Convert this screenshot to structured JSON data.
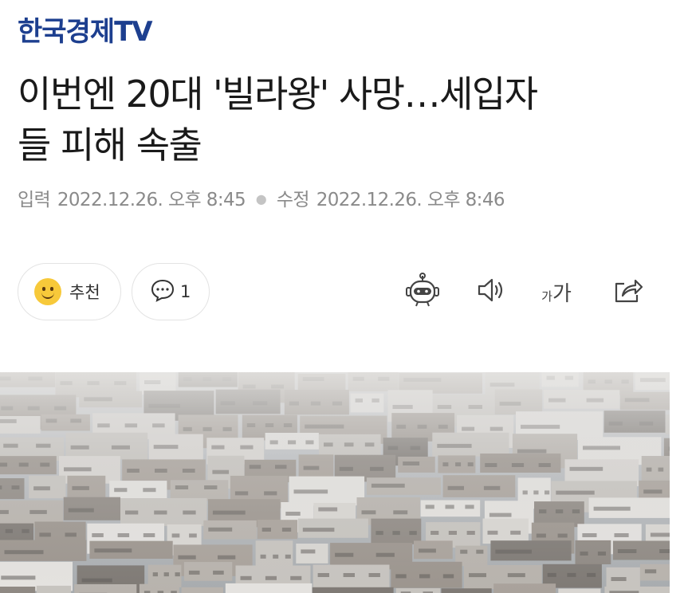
{
  "brand": {
    "name": "한국경제TV"
  },
  "article": {
    "headline_line1": "이번엔 20대 '빌라왕' 사망…세입자",
    "headline_line2": "들 피해 속출",
    "input_label": "입력",
    "input_date": "2022.12.26. 오후 8:45",
    "edit_label": "수정",
    "edit_date": "2022.12.26. 오후 8:46"
  },
  "actions": {
    "like_label": "추천",
    "comment_count": "1",
    "font_small": "가",
    "font_big": "가"
  },
  "icons": {
    "like": "smiley-icon",
    "comment": "speech-bubble-icon",
    "summary": "robot-icon",
    "tts": "speaker-icon",
    "font": "font-size-icon",
    "share": "share-icon"
  },
  "colors": {
    "brand": "#1d3f8f",
    "meta": "#8a8a8a",
    "smiley": "#f7c93a"
  }
}
